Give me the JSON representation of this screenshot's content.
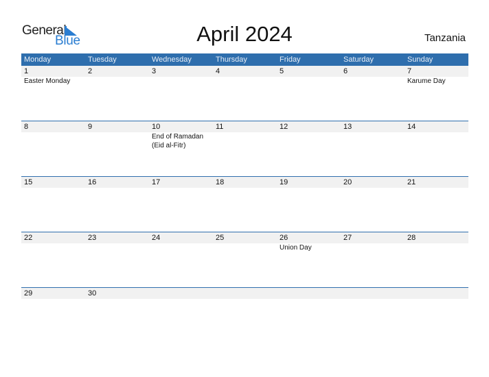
{
  "logo": {
    "word1": "General",
    "word2": "Blue"
  },
  "title": "April 2024",
  "country": "Tanzania",
  "colors": {
    "header_bg": "#2e6ead",
    "brand_blue": "#2a7dd1",
    "day_row_bg": "#f1f1f1"
  },
  "weekdays": [
    "Monday",
    "Tuesday",
    "Wednesday",
    "Thursday",
    "Friday",
    "Saturday",
    "Sunday"
  ],
  "weeks": [
    {
      "days": [
        {
          "num": "1",
          "events": [
            "Easter Monday"
          ]
        },
        {
          "num": "2",
          "events": []
        },
        {
          "num": "3",
          "events": []
        },
        {
          "num": "4",
          "events": []
        },
        {
          "num": "5",
          "events": []
        },
        {
          "num": "6",
          "events": []
        },
        {
          "num": "7",
          "events": [
            "Karume Day"
          ]
        }
      ]
    },
    {
      "days": [
        {
          "num": "8",
          "events": []
        },
        {
          "num": "9",
          "events": []
        },
        {
          "num": "10",
          "events": [
            "End of Ramadan",
            "(Eid al-Fitr)"
          ]
        },
        {
          "num": "11",
          "events": []
        },
        {
          "num": "12",
          "events": []
        },
        {
          "num": "13",
          "events": []
        },
        {
          "num": "14",
          "events": []
        }
      ]
    },
    {
      "days": [
        {
          "num": "15",
          "events": []
        },
        {
          "num": "16",
          "events": []
        },
        {
          "num": "17",
          "events": []
        },
        {
          "num": "18",
          "events": []
        },
        {
          "num": "19",
          "events": []
        },
        {
          "num": "20",
          "events": []
        },
        {
          "num": "21",
          "events": []
        }
      ]
    },
    {
      "days": [
        {
          "num": "22",
          "events": []
        },
        {
          "num": "23",
          "events": []
        },
        {
          "num": "24",
          "events": []
        },
        {
          "num": "25",
          "events": []
        },
        {
          "num": "26",
          "events": [
            "Union Day"
          ]
        },
        {
          "num": "27",
          "events": []
        },
        {
          "num": "28",
          "events": []
        }
      ]
    },
    {
      "days": [
        {
          "num": "29",
          "events": []
        },
        {
          "num": "30",
          "events": []
        },
        {
          "num": "",
          "events": []
        },
        {
          "num": "",
          "events": []
        },
        {
          "num": "",
          "events": []
        },
        {
          "num": "",
          "events": []
        },
        {
          "num": "",
          "events": []
        }
      ]
    }
  ]
}
